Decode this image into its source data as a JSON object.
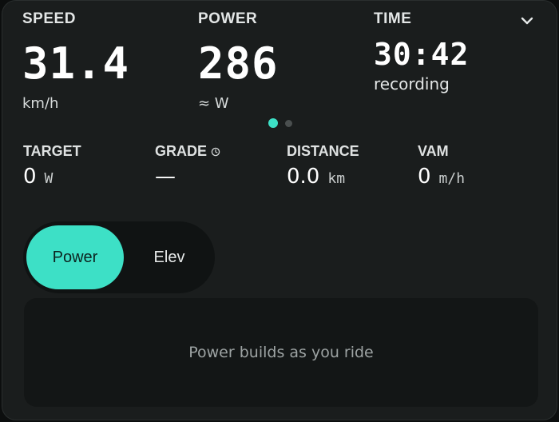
{
  "primary_stats": {
    "speed": {
      "label": "SPEED",
      "value": "31.4",
      "unit": "km/h"
    },
    "power": {
      "label": "POWER",
      "value": "286",
      "unit": "≈ W"
    },
    "time": {
      "label": "TIME",
      "value": "30:42",
      "status": "recording"
    }
  },
  "pager": {
    "active_index": 0,
    "count": 2
  },
  "secondary_stats": {
    "target": {
      "label": "TARGET",
      "value": "0",
      "unit": "W"
    },
    "grade": {
      "label": "GRADE",
      "value": "—",
      "icon": "clock-icon"
    },
    "distance": {
      "label": "DISTANCE",
      "value": "0.0",
      "unit": "km"
    },
    "vam": {
      "label": "VAM",
      "value": "0",
      "unit": "m/h"
    }
  },
  "chart_toggle": {
    "options": [
      "Power",
      "Elev"
    ],
    "selected": "Power"
  },
  "chart_panel": {
    "empty_message": "Power builds as you ride"
  },
  "colors": {
    "accent": "#3de0c6",
    "panel_bg": "#1a1d1d",
    "chart_bg": "#131616"
  }
}
